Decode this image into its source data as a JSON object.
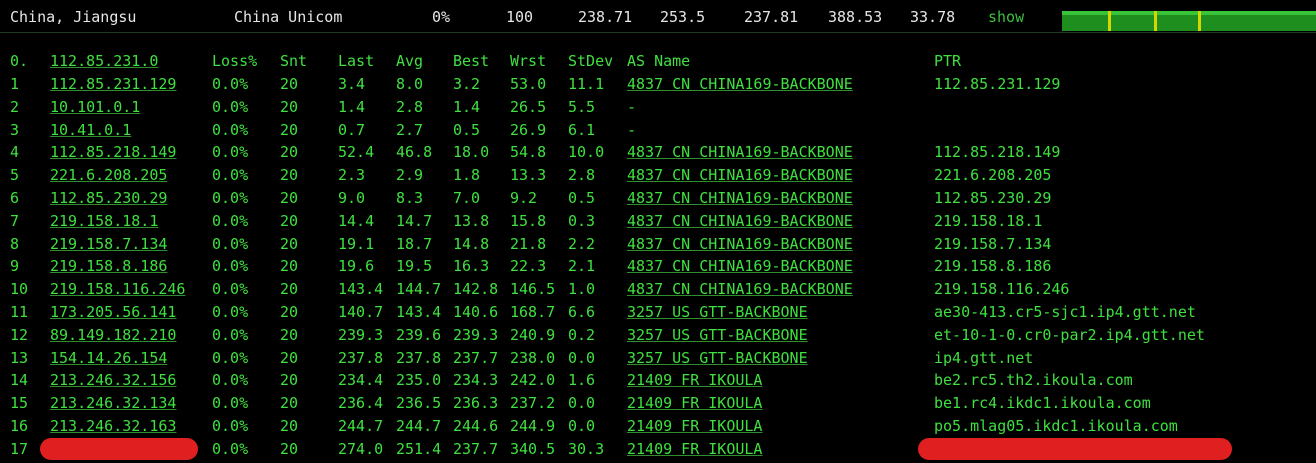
{
  "header": {
    "location": "China, Jiangsu",
    "isp": "China Unicom",
    "loss": "0%",
    "sent": "100",
    "v1": "238.71",
    "v2": "253.5",
    "v3": "237.81",
    "v4": "388.53",
    "v5": "33.78",
    "show_label": "show"
  },
  "columns": {
    "num": "0.",
    "host": "112.85.231.0",
    "loss": "Loss%",
    "snt": "Snt",
    "last": "Last",
    "avg": "Avg",
    "best": "Best",
    "wrst": "Wrst",
    "stdev": "StDev",
    "asname": "AS Name",
    "ptr": "PTR"
  },
  "rows": [
    {
      "num": "1",
      "host": "112.85.231.129",
      "loss": "0.0%",
      "snt": "20",
      "last": "3.4",
      "avg": "8.0",
      "best": "3.2",
      "wrst": "53.0",
      "stdev": "11.1",
      "as": "4837  CN CHINA169-BACKBONE",
      "ptr": "112.85.231.129"
    },
    {
      "num": "2",
      "host": "10.101.0.1",
      "loss": "0.0%",
      "snt": "20",
      "last": "1.4",
      "avg": "2.8",
      "best": "1.4",
      "wrst": "26.5",
      "stdev": "5.5",
      "as": "-",
      "ptr": ""
    },
    {
      "num": "3",
      "host": "10.41.0.1",
      "loss": "0.0%",
      "snt": "20",
      "last": "0.7",
      "avg": "2.7",
      "best": "0.5",
      "wrst": "26.9",
      "stdev": "6.1",
      "as": "-",
      "ptr": ""
    },
    {
      "num": "4",
      "host": "112.85.218.149",
      "loss": "0.0%",
      "snt": "20",
      "last": "52.4",
      "avg": "46.8",
      "best": "18.0",
      "wrst": "54.8",
      "stdev": "10.0",
      "as": "4837  CN CHINA169-BACKBONE",
      "ptr": "112.85.218.149"
    },
    {
      "num": "5",
      "host": "221.6.208.205",
      "loss": "0.0%",
      "snt": "20",
      "last": "2.3",
      "avg": "2.9",
      "best": "1.8",
      "wrst": "13.3",
      "stdev": "2.8",
      "as": "4837  CN CHINA169-BACKBONE",
      "ptr": "221.6.208.205"
    },
    {
      "num": "6",
      "host": "112.85.230.29",
      "loss": "0.0%",
      "snt": "20",
      "last": "9.0",
      "avg": "8.3",
      "best": "7.0",
      "wrst": "9.2",
      "stdev": "0.5",
      "as": "4837  CN CHINA169-BACKBONE",
      "ptr": "112.85.230.29"
    },
    {
      "num": "7",
      "host": "219.158.18.1",
      "loss": "0.0%",
      "snt": "20",
      "last": "14.4",
      "avg": "14.7",
      "best": "13.8",
      "wrst": "15.8",
      "stdev": "0.3",
      "as": "4837  CN CHINA169-BACKBONE",
      "ptr": "219.158.18.1"
    },
    {
      "num": "8",
      "host": "219.158.7.134",
      "loss": "0.0%",
      "snt": "20",
      "last": "19.1",
      "avg": "18.7",
      "best": "14.8",
      "wrst": "21.8",
      "stdev": "2.2",
      "as": "4837  CN CHINA169-BACKBONE",
      "ptr": "219.158.7.134"
    },
    {
      "num": "9",
      "host": "219.158.8.186",
      "loss": "0.0%",
      "snt": "20",
      "last": "19.6",
      "avg": "19.5",
      "best": "16.3",
      "wrst": "22.3",
      "stdev": "2.1",
      "as": "4837  CN CHINA169-BACKBONE",
      "ptr": "219.158.8.186"
    },
    {
      "num": "10",
      "host": "219.158.116.246",
      "loss": "0.0%",
      "snt": "20",
      "last": "143.4",
      "avg": "144.7",
      "best": "142.8",
      "wrst": "146.5",
      "stdev": "1.0",
      "as": "4837  CN CHINA169-BACKBONE",
      "ptr": "219.158.116.246"
    },
    {
      "num": "11",
      "host": "173.205.56.141",
      "loss": "0.0%",
      "snt": "20",
      "last": "140.7",
      "avg": "143.4",
      "best": "140.6",
      "wrst": "168.7",
      "stdev": "6.6",
      "as": "3257  US GTT-BACKBONE",
      "ptr": "ae30-413.cr5-sjc1.ip4.gtt.net"
    },
    {
      "num": "12",
      "host": "89.149.182.210",
      "loss": "0.0%",
      "snt": "20",
      "last": "239.3",
      "avg": "239.6",
      "best": "239.3",
      "wrst": "240.9",
      "stdev": "0.2",
      "as": "3257  US GTT-BACKBONE",
      "ptr": "et-10-1-0.cr0-par2.ip4.gtt.net"
    },
    {
      "num": "13",
      "host": "154.14.26.154",
      "loss": "0.0%",
      "snt": "20",
      "last": "237.8",
      "avg": "237.8",
      "best": "237.7",
      "wrst": "238.0",
      "stdev": "0.0",
      "as": "3257  US GTT-BACKBONE",
      "ptr": "ip4.gtt.net"
    },
    {
      "num": "14",
      "host": "213.246.32.156",
      "loss": "0.0%",
      "snt": "20",
      "last": "234.4",
      "avg": "235.0",
      "best": "234.3",
      "wrst": "242.0",
      "stdev": "1.6",
      "as": "21409 FR IKOULA",
      "ptr": "be2.rc5.th2.ikoula.com"
    },
    {
      "num": "15",
      "host": "213.246.32.134",
      "loss": "0.0%",
      "snt": "20",
      "last": "236.4",
      "avg": "236.5",
      "best": "236.3",
      "wrst": "237.2",
      "stdev": "0.0",
      "as": "21409 FR IKOULA",
      "ptr": "be1.rc4.ikdc1.ikoula.com"
    },
    {
      "num": "16",
      "host": "213.246.32.163",
      "loss": "0.0%",
      "snt": "20",
      "last": "244.7",
      "avg": "244.7",
      "best": "244.6",
      "wrst": "244.9",
      "stdev": "0.0",
      "as": "21409 FR IKOULA",
      "ptr": "po5.mlag05.ikdc1.ikoula.com"
    },
    {
      "num": "17",
      "host": "",
      "loss": "0.0%",
      "snt": "20",
      "last": "274.0",
      "avg": "251.4",
      "best": "237.7",
      "wrst": "340.5",
      "stdev": "30.3",
      "as": "21409 FR IKOULA",
      "ptr": ""
    }
  ],
  "colors": {
    "text_green": "#3fe03f",
    "background": "#000000",
    "redaction": "#e02020",
    "sparkline": "#1e8f1e",
    "tick": "#d6d600"
  }
}
